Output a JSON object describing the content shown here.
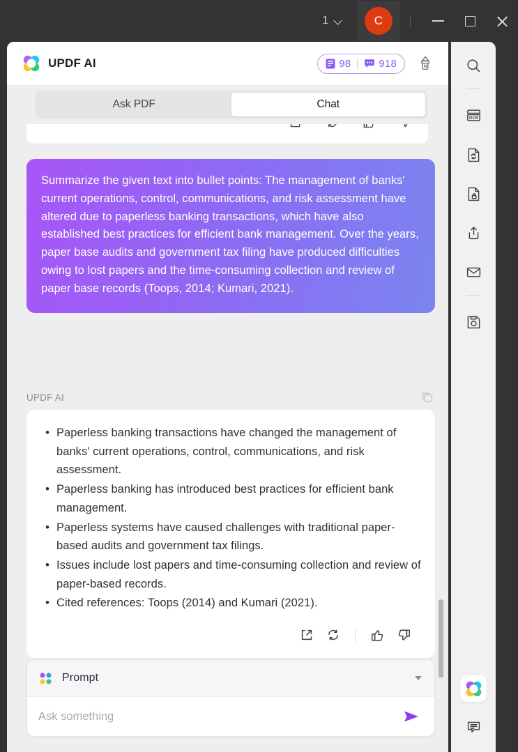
{
  "titlebar": {
    "page_number": "1",
    "page_chevron_icon": "chevron-down-icon",
    "avatar_initial": "C",
    "avatar_color": "#dd3b12",
    "minimize_label": "—",
    "maximize_label": "□",
    "close_label": "✕"
  },
  "header": {
    "logo_icon": "updf-clover-logo-icon",
    "title": "UPDF AI",
    "credits": {
      "document_icon": "document-credit-icon",
      "document_count": "98",
      "chat_icon": "chat-credit-icon",
      "chat_count": "918",
      "border_color": "#b89bf0",
      "text_color": "#8b5cf6"
    },
    "clear_icon": "brush-clear-icon"
  },
  "tabs": [
    {
      "label": "Ask PDF",
      "active": false
    },
    {
      "label": "Chat",
      "active": true
    }
  ],
  "conversation": {
    "user_message": "Summarize the given text into bullet points: The management of banks' current operations, control, communications, and risk assessment have altered due to paperless banking transactions, which have also established best practices for efficient bank management. Over the years, paper base audits and government tax filing have produced difficulties owing to lost papers and the time-consuming collection and review of paper base records (Toops, 2014; Kumari, 2021).",
    "user_bubble_gradient_from": "#a855f7",
    "user_bubble_gradient_to": "#7b85f0",
    "ai_label": "UPDF AI",
    "copy_icon": "copy-icon",
    "ai_bullets": [
      "Paperless banking transactions have changed the management of banks' current operations, control, communications, and risk assessment.",
      "Paperless banking has introduced best practices for efficient bank management.",
      "Paperless systems have caused challenges with traditional paper-based audits and government tax filings.",
      "Issues include lost papers and time-consuming collection and review of paper-based records.",
      "Cited references: Toops (2014) and Kumari (2021)."
    ],
    "ai_actions": [
      {
        "icon": "external-link-icon"
      },
      {
        "icon": "regenerate-icon"
      },
      {
        "icon": "thumbs-up-icon"
      },
      {
        "icon": "thumbs-down-icon"
      }
    ]
  },
  "composer": {
    "prompt_icon": "four-dots-icon",
    "prompt_label": "Prompt",
    "prompt_caret_icon": "caret-down-icon",
    "input_value": "",
    "input_placeholder": "Ask something",
    "send_icon": "send-arrow-icon",
    "send_color": "#8b3df0"
  },
  "right_rail": {
    "items": [
      {
        "icon": "search-icon"
      },
      {
        "icon": "ocr-icon"
      },
      {
        "icon": "convert-document-icon"
      },
      {
        "icon": "protect-document-icon"
      },
      {
        "icon": "share-icon"
      },
      {
        "icon": "email-icon"
      },
      {
        "icon": "save-icon"
      }
    ],
    "bottom": [
      {
        "icon": "updf-ai-logo-icon"
      },
      {
        "icon": "comment-icon"
      }
    ]
  }
}
